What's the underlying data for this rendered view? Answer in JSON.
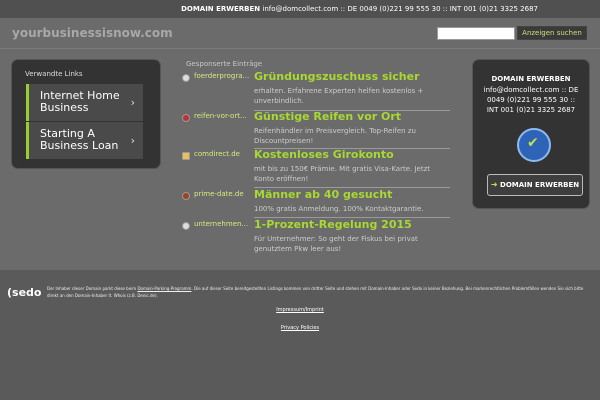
{
  "topbar": {
    "label": "DOMAIN ERWERBEN",
    "contact": "info@domcollect.com :: DE 0049 (0)221 99 555 30 :: INT 001 (0)21 3325 2687"
  },
  "header": {
    "site_name": "yourbusinessisnow.com",
    "search_value": "",
    "search_button": "Anzeigen suchen"
  },
  "related": {
    "title": "Verwandte Links",
    "items": [
      {
        "label": "Internet Home Business"
      },
      {
        "label": "Starting A Business Loan"
      }
    ]
  },
  "sponsored": {
    "title": "Gesponserte Einträge",
    "entries": [
      {
        "source": "foerderprogra...",
        "headline": "Gründungszuschuss sicher",
        "desc": "erhalten. Erfahrene Experten helfen kostenlos + unverbindlich."
      },
      {
        "source": "reifen-vor-ort...",
        "headline": "Günstige Reifen vor Ort",
        "desc": "Reifenhändler im Preisvergleich. Top-Reifen zu Discountpreisen!"
      },
      {
        "source": "comdirect.de",
        "headline": "Kostenloses Girokonto",
        "desc": "mit bis zu 150€ Prämie. Mit gratis Visa-Karte. Jetzt Konto eröffnen!"
      },
      {
        "source": "prime-date.de",
        "headline": "Männer ab 40 gesucht",
        "desc": "100% gratis Anmeldung. 100% Kontaktgarantie."
      },
      {
        "source": "unternehmen...",
        "headline": "1-Prozent-Regelung 2015",
        "desc": "Für Unternehmer: So geht der Fiskus bei privat genutztem Pkw leer aus!"
      }
    ]
  },
  "sidebox": {
    "title": "DOMAIN ERWERBEN",
    "text": "info@domcollect.com :: DE 0049 (0)221 99 555 30 :: INT 001 (0)21 3325 2687",
    "button": "DOMAIN ERWERBEN"
  },
  "footer": {
    "logo": "sedo",
    "disclaimer_pre": "Der Inhaber dieser Domain parkt diese beim ",
    "disclaimer_link": "Domain-Parking-Programm",
    "disclaimer_post": ". Die auf dieser Seite bereitgestellten Listings kommen von dritter Seite und stehen mit Domain-Inhaber oder Sedo in keiner Beziehung. Bei markenrechtlichen Problemfällen wenden Sie sich bitte direkt an den Domain-Inhaber lt. Whois (z.B. Denic.de).",
    "imprint": "Impressum/Imprint",
    "privacy": "Privacy Policies"
  }
}
